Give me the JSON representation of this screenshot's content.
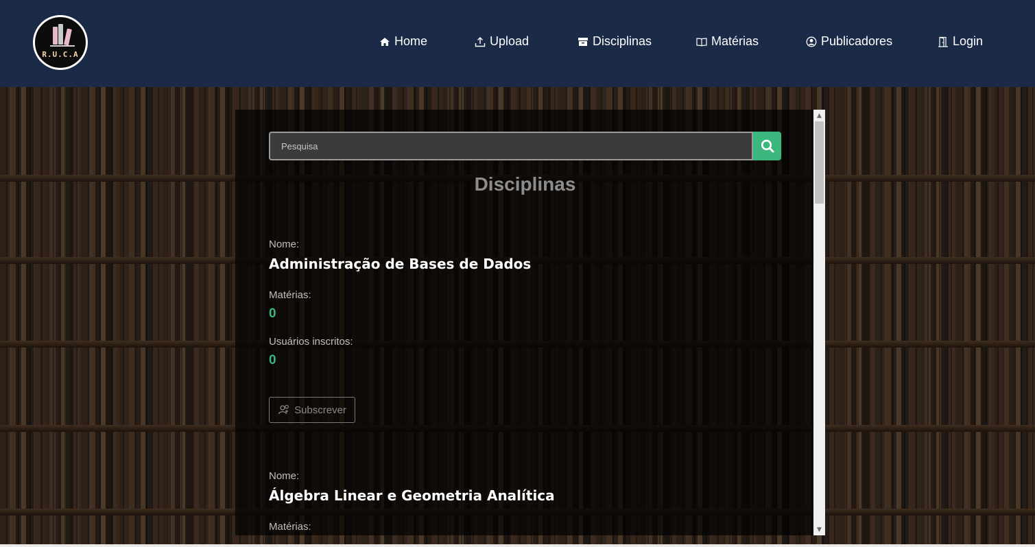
{
  "logo": {
    "text": "R.U.C.A"
  },
  "nav": [
    {
      "label": "Home",
      "icon": "home-icon"
    },
    {
      "label": "Upload",
      "icon": "upload-icon"
    },
    {
      "label": "Disciplinas",
      "icon": "archive-icon"
    },
    {
      "label": "Matérias",
      "icon": "book-icon"
    },
    {
      "label": "Publicadores",
      "icon": "user-circle-icon"
    },
    {
      "label": "Login",
      "icon": "door-icon"
    }
  ],
  "search": {
    "placeholder": "Pesquisa"
  },
  "page": {
    "title": "Disciplinas"
  },
  "disciplinas": [
    {
      "name_label": "Nome:",
      "name": "Administração de Bases de Dados",
      "materias_label": "Matérias:",
      "materias": "0",
      "usuarios_label": "Usuários inscritos:",
      "usuarios": "0",
      "subscribe_label": "Subscrever"
    },
    {
      "name_label": "Nome:",
      "name": "Álgebra Linear e Geometria Analítica",
      "materias_label": "Matérias:"
    }
  ],
  "colors": {
    "header": "#1b2a47",
    "accent": "#3bb77e"
  }
}
